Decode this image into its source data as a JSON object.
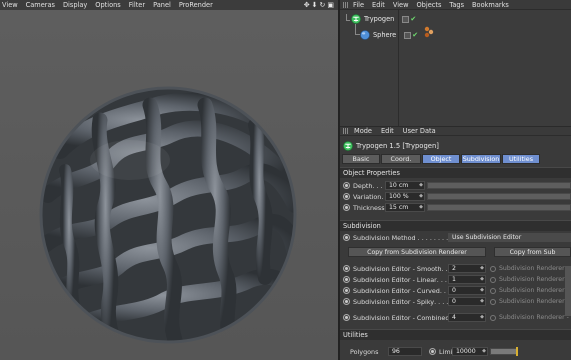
{
  "viewport": {
    "menu": [
      "View",
      "Cameras",
      "Display",
      "Options",
      "Filter",
      "Panel",
      "ProRender"
    ],
    "nav_icons": [
      "move-icon",
      "arrow-down-icon",
      "refresh-icon",
      "maximize-icon"
    ]
  },
  "object_manager": {
    "menu": [
      "File",
      "Edit",
      "View",
      "Objects",
      "Tags",
      "Bookmarks"
    ],
    "objects": [
      {
        "name": "Trypogen"
      },
      {
        "name": "Sphere"
      }
    ]
  },
  "attribute_manager": {
    "menu": [
      "Mode",
      "Edit",
      "User Data"
    ],
    "object_title": "Trypogen 1.5 [Trypogen]",
    "tabs": [
      {
        "label": "Basic",
        "active": false
      },
      {
        "label": "Coord.",
        "active": false
      },
      {
        "label": "Object",
        "active": true
      },
      {
        "label": "Subdivision",
        "active": true
      },
      {
        "label": "Utilities",
        "active": true
      }
    ],
    "object_properties": {
      "title": "Object Properties",
      "params": [
        {
          "label": "Depth",
          "value": "10 cm"
        },
        {
          "label": "Variation",
          "value": "100 %"
        },
        {
          "label": "Thickness",
          "value": "15 cm"
        }
      ]
    },
    "subdivision": {
      "title": "Subdivision",
      "method_label": "Subdivision Method . . . . . . . . .",
      "method_value": "Use Subdivision Editor",
      "copy_btn_1": "Copy from Subdivision Renderer",
      "copy_btn_2": "Copy from Sub",
      "editor_params": [
        {
          "label": "Subdivision Editor - Smooth",
          "value": "2",
          "renderer": "Subdivision Renderer -"
        },
        {
          "label": "Subdivision Editor - Linear",
          "value": "1",
          "renderer": "Subdivision Renderer -"
        },
        {
          "label": "Subdivision Editor - Curved",
          "value": "0",
          "renderer": "Subdivision Renderer -"
        },
        {
          "label": "Subdivision Editor - Spiky",
          "value": "0",
          "renderer": "Subdivision Renderer -"
        },
        {
          "label": "Subdivision Editor - Combined",
          "value": "4",
          "renderer": "Subdivision Renderer -"
        }
      ]
    },
    "utilities": {
      "title": "Utilities",
      "polygons_label": "Polygons",
      "polygons_value": "96",
      "limit_label": "Limit",
      "limit_value": "10000"
    }
  },
  "colors": {
    "viewport_bg": "#5a5a5a",
    "panel_bg": "#3a3a3a",
    "tab_active": "#6f8fd0",
    "accent_green": "#3fbf5f"
  }
}
